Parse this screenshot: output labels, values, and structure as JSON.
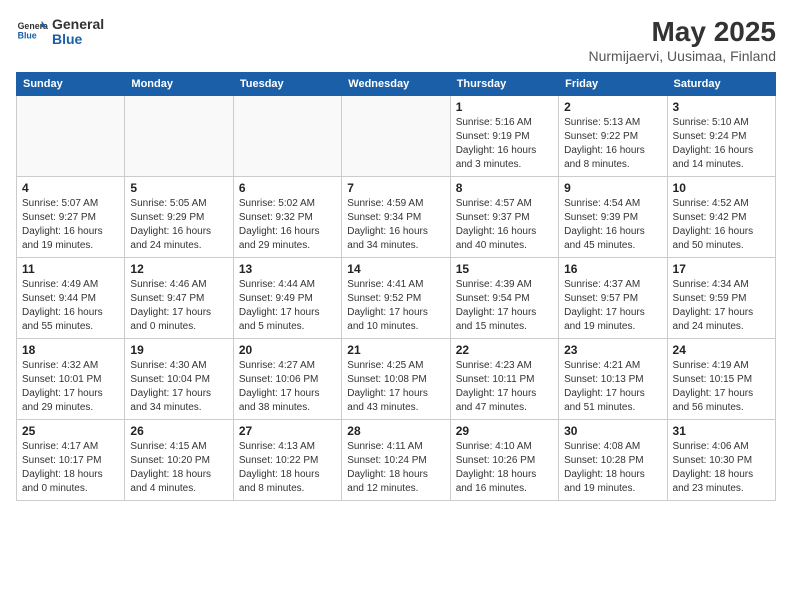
{
  "header": {
    "logo_general": "General",
    "logo_blue": "Blue",
    "month_title": "May 2025",
    "location": "Nurmijaervi, Uusimaa, Finland"
  },
  "weekdays": [
    "Sunday",
    "Monday",
    "Tuesday",
    "Wednesday",
    "Thursday",
    "Friday",
    "Saturday"
  ],
  "weeks": [
    [
      {
        "day": "",
        "info": ""
      },
      {
        "day": "",
        "info": ""
      },
      {
        "day": "",
        "info": ""
      },
      {
        "day": "",
        "info": ""
      },
      {
        "day": "1",
        "info": "Sunrise: 5:16 AM\nSunset: 9:19 PM\nDaylight: 16 hours\nand 3 minutes."
      },
      {
        "day": "2",
        "info": "Sunrise: 5:13 AM\nSunset: 9:22 PM\nDaylight: 16 hours\nand 8 minutes."
      },
      {
        "day": "3",
        "info": "Sunrise: 5:10 AM\nSunset: 9:24 PM\nDaylight: 16 hours\nand 14 minutes."
      }
    ],
    [
      {
        "day": "4",
        "info": "Sunrise: 5:07 AM\nSunset: 9:27 PM\nDaylight: 16 hours\nand 19 minutes."
      },
      {
        "day": "5",
        "info": "Sunrise: 5:05 AM\nSunset: 9:29 PM\nDaylight: 16 hours\nand 24 minutes."
      },
      {
        "day": "6",
        "info": "Sunrise: 5:02 AM\nSunset: 9:32 PM\nDaylight: 16 hours\nand 29 minutes."
      },
      {
        "day": "7",
        "info": "Sunrise: 4:59 AM\nSunset: 9:34 PM\nDaylight: 16 hours\nand 34 minutes."
      },
      {
        "day": "8",
        "info": "Sunrise: 4:57 AM\nSunset: 9:37 PM\nDaylight: 16 hours\nand 40 minutes."
      },
      {
        "day": "9",
        "info": "Sunrise: 4:54 AM\nSunset: 9:39 PM\nDaylight: 16 hours\nand 45 minutes."
      },
      {
        "day": "10",
        "info": "Sunrise: 4:52 AM\nSunset: 9:42 PM\nDaylight: 16 hours\nand 50 minutes."
      }
    ],
    [
      {
        "day": "11",
        "info": "Sunrise: 4:49 AM\nSunset: 9:44 PM\nDaylight: 16 hours\nand 55 minutes."
      },
      {
        "day": "12",
        "info": "Sunrise: 4:46 AM\nSunset: 9:47 PM\nDaylight: 17 hours\nand 0 minutes."
      },
      {
        "day": "13",
        "info": "Sunrise: 4:44 AM\nSunset: 9:49 PM\nDaylight: 17 hours\nand 5 minutes."
      },
      {
        "day": "14",
        "info": "Sunrise: 4:41 AM\nSunset: 9:52 PM\nDaylight: 17 hours\nand 10 minutes."
      },
      {
        "day": "15",
        "info": "Sunrise: 4:39 AM\nSunset: 9:54 PM\nDaylight: 17 hours\nand 15 minutes."
      },
      {
        "day": "16",
        "info": "Sunrise: 4:37 AM\nSunset: 9:57 PM\nDaylight: 17 hours\nand 19 minutes."
      },
      {
        "day": "17",
        "info": "Sunrise: 4:34 AM\nSunset: 9:59 PM\nDaylight: 17 hours\nand 24 minutes."
      }
    ],
    [
      {
        "day": "18",
        "info": "Sunrise: 4:32 AM\nSunset: 10:01 PM\nDaylight: 17 hours\nand 29 minutes."
      },
      {
        "day": "19",
        "info": "Sunrise: 4:30 AM\nSunset: 10:04 PM\nDaylight: 17 hours\nand 34 minutes."
      },
      {
        "day": "20",
        "info": "Sunrise: 4:27 AM\nSunset: 10:06 PM\nDaylight: 17 hours\nand 38 minutes."
      },
      {
        "day": "21",
        "info": "Sunrise: 4:25 AM\nSunset: 10:08 PM\nDaylight: 17 hours\nand 43 minutes."
      },
      {
        "day": "22",
        "info": "Sunrise: 4:23 AM\nSunset: 10:11 PM\nDaylight: 17 hours\nand 47 minutes."
      },
      {
        "day": "23",
        "info": "Sunrise: 4:21 AM\nSunset: 10:13 PM\nDaylight: 17 hours\nand 51 minutes."
      },
      {
        "day": "24",
        "info": "Sunrise: 4:19 AM\nSunset: 10:15 PM\nDaylight: 17 hours\nand 56 minutes."
      }
    ],
    [
      {
        "day": "25",
        "info": "Sunrise: 4:17 AM\nSunset: 10:17 PM\nDaylight: 18 hours\nand 0 minutes."
      },
      {
        "day": "26",
        "info": "Sunrise: 4:15 AM\nSunset: 10:20 PM\nDaylight: 18 hours\nand 4 minutes."
      },
      {
        "day": "27",
        "info": "Sunrise: 4:13 AM\nSunset: 10:22 PM\nDaylight: 18 hours\nand 8 minutes."
      },
      {
        "day": "28",
        "info": "Sunrise: 4:11 AM\nSunset: 10:24 PM\nDaylight: 18 hours\nand 12 minutes."
      },
      {
        "day": "29",
        "info": "Sunrise: 4:10 AM\nSunset: 10:26 PM\nDaylight: 18 hours\nand 16 minutes."
      },
      {
        "day": "30",
        "info": "Sunrise: 4:08 AM\nSunset: 10:28 PM\nDaylight: 18 hours\nand 19 minutes."
      },
      {
        "day": "31",
        "info": "Sunrise: 4:06 AM\nSunset: 10:30 PM\nDaylight: 18 hours\nand 23 minutes."
      }
    ]
  ]
}
